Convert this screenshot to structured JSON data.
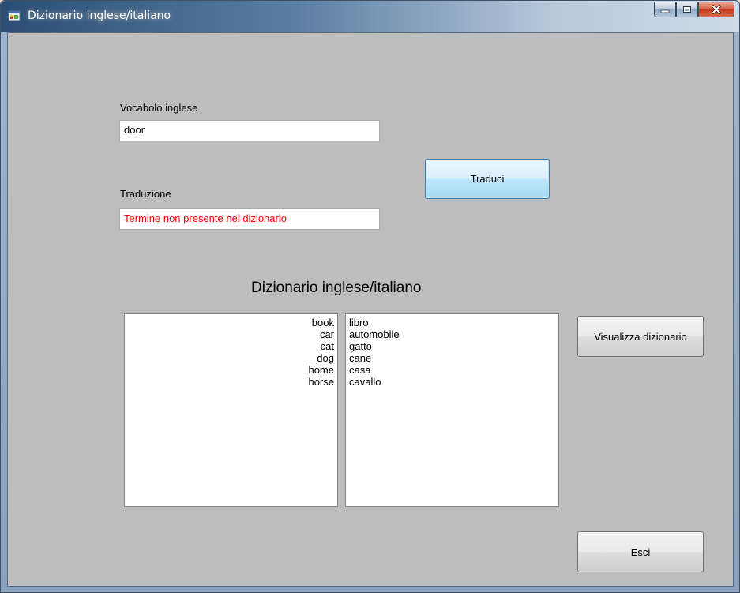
{
  "window": {
    "title": "Dizionario inglese/italiano",
    "icons": {
      "app": "form-icon",
      "minimize": "minimize-icon",
      "maximize": "maximize-icon",
      "close": "close-icon"
    }
  },
  "form": {
    "english_label": "Vocabolo inglese",
    "english_value": "door",
    "translation_label": "Traduzione",
    "translation_value": "Termine non presente nel dizionario",
    "translation_color": "#ff0000",
    "translate_button": "Traduci",
    "dictionary_title": "Dizionario inglese/italiano",
    "english_list": [
      "book",
      "car",
      "cat",
      "dog",
      "home",
      "horse"
    ],
    "italian_list": [
      "libro",
      "automobile",
      "gatto",
      "cane",
      "casa",
      "cavallo"
    ],
    "show_dictionary_button": "Visualizza dizionario",
    "exit_button": "Esci"
  }
}
